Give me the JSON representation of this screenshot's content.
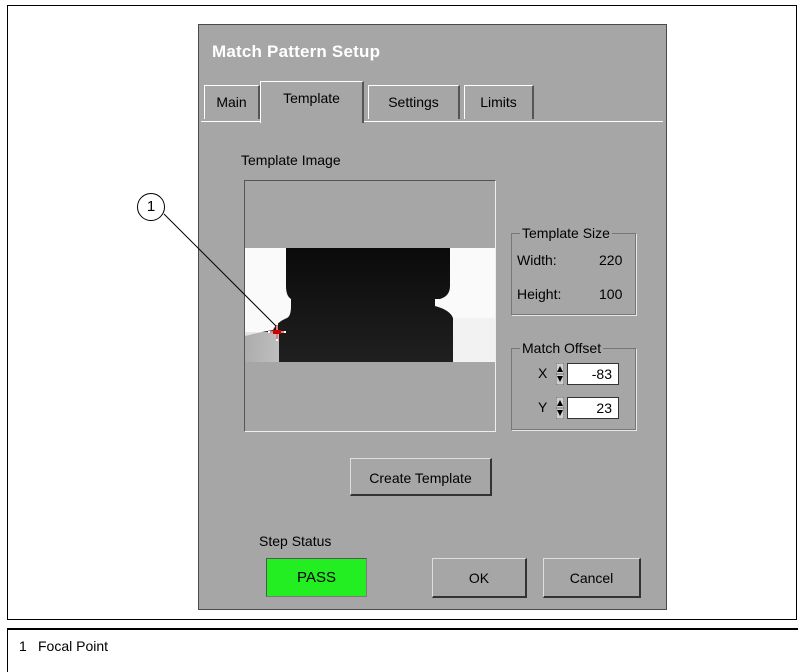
{
  "dialog": {
    "title": "Match Pattern Setup",
    "tabs": [
      {
        "label": "Main"
      },
      {
        "label": "Template"
      },
      {
        "label": "Settings"
      },
      {
        "label": "Limits"
      }
    ],
    "active_tab": "Template"
  },
  "template_image": {
    "label": "Template Image"
  },
  "template_size": {
    "legend": "Template Size",
    "width_label": "Width:",
    "width_value": "220",
    "height_label": "Height:",
    "height_value": "100"
  },
  "match_offset": {
    "legend": "Match Offset",
    "x_label": "X",
    "x_value": "-83",
    "y_label": "Y",
    "y_value": "23"
  },
  "buttons": {
    "create_template": "Create Template",
    "ok": "OK",
    "cancel": "Cancel"
  },
  "step_status": {
    "label": "Step Status",
    "value": "PASS",
    "color": "#22ee22"
  },
  "callout": {
    "number": "1",
    "caption_number": "1",
    "caption_text": "Focal Point"
  },
  "colors": {
    "dialog_bg": "#a6a6a6",
    "title_text": "#ffffff",
    "focal_marker": "#cc0000"
  }
}
